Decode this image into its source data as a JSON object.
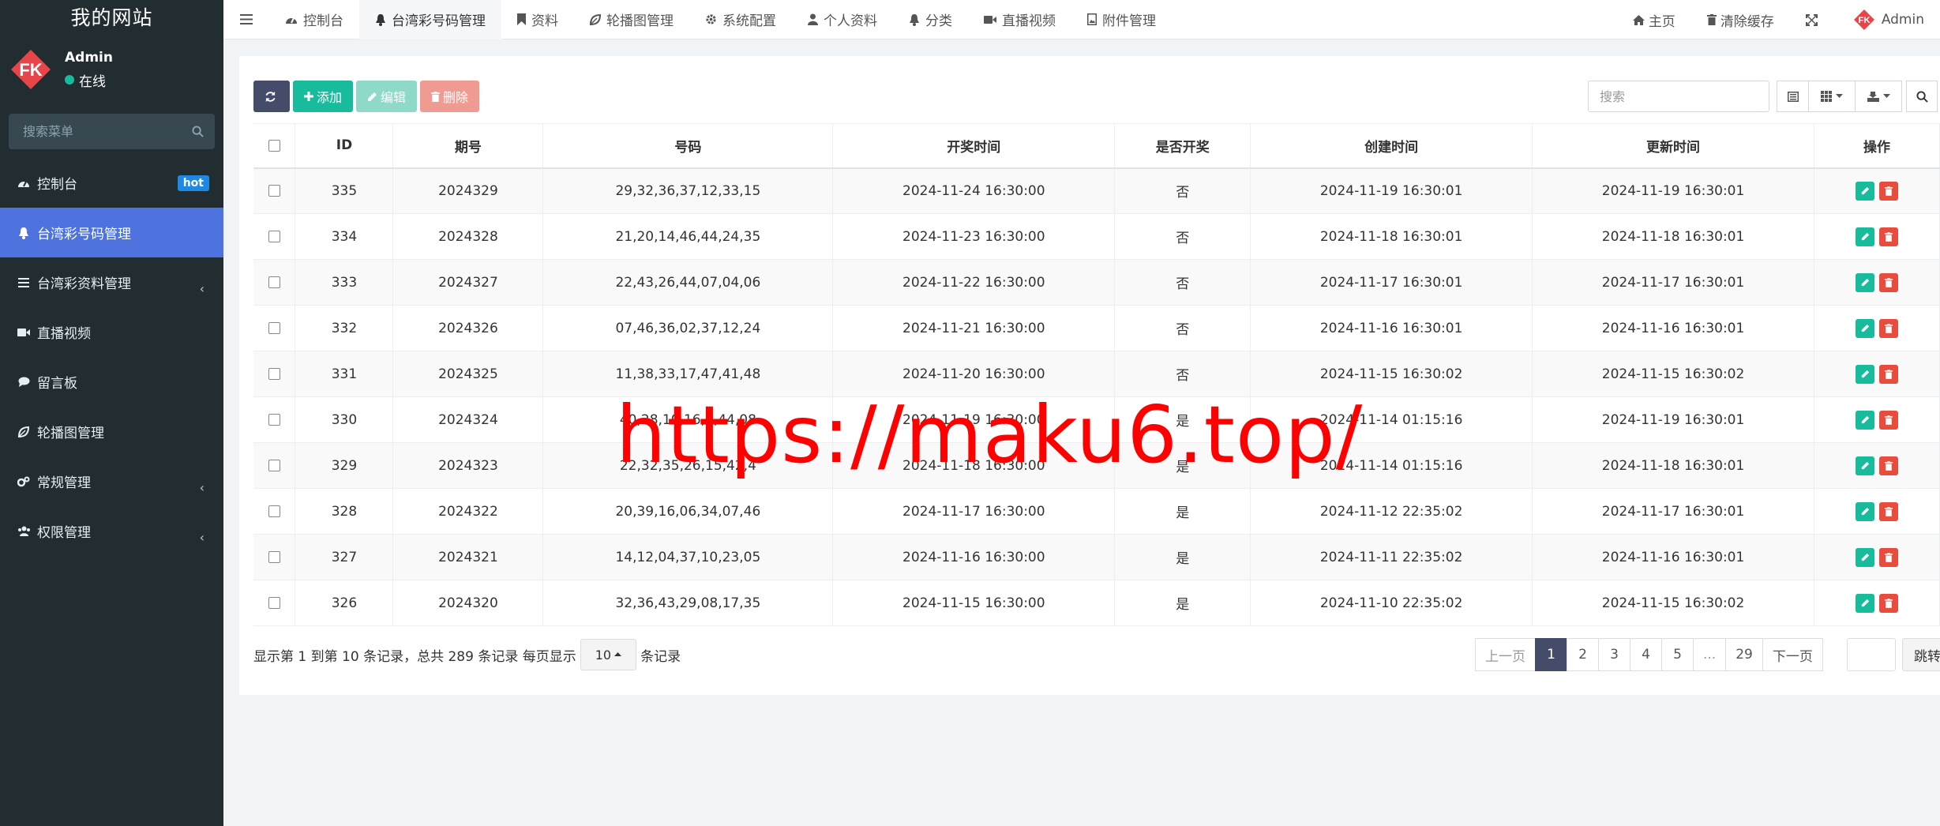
{
  "sidebar": {
    "brand": "我的网站",
    "user_name": "Admin",
    "user_status": "在线",
    "search_placeholder": "搜索菜单",
    "items": [
      {
        "label": "控制台",
        "icon": "dashboard-icon",
        "badge": "hot"
      },
      {
        "label": "台湾彩号码管理",
        "icon": "bell-icon",
        "active": true
      },
      {
        "label": "台湾彩资料管理",
        "icon": "list-icon",
        "chevron": true
      },
      {
        "label": "直播视频",
        "icon": "video-icon"
      },
      {
        "label": "留言板",
        "icon": "comment-icon"
      },
      {
        "label": "轮播图管理",
        "icon": "leaf-icon"
      },
      {
        "label": "常规管理",
        "icon": "cogs-icon",
        "chevron": true
      },
      {
        "label": "权限管理",
        "icon": "users-icon",
        "chevron": true
      }
    ]
  },
  "topnav": {
    "tabs": [
      {
        "label": "控制台",
        "icon": "dashboard-icon"
      },
      {
        "label": "台湾彩号码管理",
        "icon": "bell-icon",
        "active": true
      },
      {
        "label": "资料",
        "icon": "bookmark-icon"
      },
      {
        "label": "轮播图管理",
        "icon": "leaf-icon"
      },
      {
        "label": "系统配置",
        "icon": "gear-icon"
      },
      {
        "label": "个人资料",
        "icon": "user-icon"
      },
      {
        "label": "分类",
        "icon": "bell-icon"
      },
      {
        "label": "直播视频",
        "icon": "video-icon"
      },
      {
        "label": "附件管理",
        "icon": "file-image-icon"
      }
    ],
    "home": "主页",
    "clear_cache": "清除缓存",
    "admin": "Admin"
  },
  "toolbar": {
    "add": "添加",
    "edit": "编辑",
    "delete": "删除",
    "search_placeholder": "搜索"
  },
  "table": {
    "headers": [
      "ID",
      "期号",
      "号码",
      "开奖时间",
      "是否开奖",
      "创建时间",
      "更新时间",
      "操作"
    ],
    "rows": [
      {
        "id": "335",
        "issue": "2024329",
        "numbers": "29,32,36,37,12,33,15",
        "draw_time": "2024-11-24 16:30:00",
        "drawn": "否",
        "created": "2024-11-19 16:30:01",
        "updated": "2024-11-19 16:30:01"
      },
      {
        "id": "334",
        "issue": "2024328",
        "numbers": "21,20,14,46,44,24,35",
        "draw_time": "2024-11-23 16:30:00",
        "drawn": "否",
        "created": "2024-11-18 16:30:01",
        "updated": "2024-11-18 16:30:01"
      },
      {
        "id": "333",
        "issue": "2024327",
        "numbers": "22,43,26,44,07,04,06",
        "draw_time": "2024-11-22 16:30:00",
        "drawn": "否",
        "created": "2024-11-17 16:30:01",
        "updated": "2024-11-17 16:30:01"
      },
      {
        "id": "332",
        "issue": "2024326",
        "numbers": "07,46,36,02,37,12,24",
        "draw_time": "2024-11-21 16:30:00",
        "drawn": "否",
        "created": "2024-11-16 16:30:01",
        "updated": "2024-11-16 16:30:01"
      },
      {
        "id": "331",
        "issue": "2024325",
        "numbers": "11,38,33,17,47,41,48",
        "draw_time": "2024-11-20 16:30:00",
        "drawn": "否",
        "created": "2024-11-15 16:30:02",
        "updated": "2024-11-15 16:30:02"
      },
      {
        "id": "330",
        "issue": "2024324",
        "numbers": "40,28,10,16,1,44,08",
        "draw_time": "2024-11-19 16:30:00",
        "drawn": "是",
        "created": "2024-11-14 01:15:16",
        "updated": "2024-11-19 16:30:01"
      },
      {
        "id": "329",
        "issue": "2024323",
        "numbers": "22,32,35,26,15,42,4",
        "draw_time": "2024-11-18 16:30:00",
        "drawn": "是",
        "created": "2024-11-14 01:15:16",
        "updated": "2024-11-18 16:30:01"
      },
      {
        "id": "328",
        "issue": "2024322",
        "numbers": "20,39,16,06,34,07,46",
        "draw_time": "2024-11-17 16:30:00",
        "drawn": "是",
        "created": "2024-11-12 22:35:02",
        "updated": "2024-11-17 16:30:01"
      },
      {
        "id": "327",
        "issue": "2024321",
        "numbers": "14,12,04,37,10,23,05",
        "draw_time": "2024-11-16 16:30:00",
        "drawn": "是",
        "created": "2024-11-11 22:35:02",
        "updated": "2024-11-16 16:30:01"
      },
      {
        "id": "326",
        "issue": "2024320",
        "numbers": "32,36,43,29,08,17,35",
        "draw_time": "2024-11-15 16:30:00",
        "drawn": "是",
        "created": "2024-11-10 22:35:02",
        "updated": "2024-11-15 16:30:02"
      }
    ]
  },
  "footer": {
    "info_prefix": "显示第 1 到第 10 条记录，总共 289 条记录 每页显示",
    "page_size": "10",
    "info_suffix": "条记录",
    "pages": [
      "上一页",
      "1",
      "2",
      "3",
      "4",
      "5",
      "...",
      "29",
      "下一页"
    ],
    "active_page": "1",
    "jump": "跳转"
  },
  "watermark": "https://maku6.top/",
  "colors": {
    "sidebar": "#222d32",
    "active": "#4e73df",
    "success": "#18bc9c",
    "danger": "#e74c3c",
    "primary": "#444c69"
  }
}
